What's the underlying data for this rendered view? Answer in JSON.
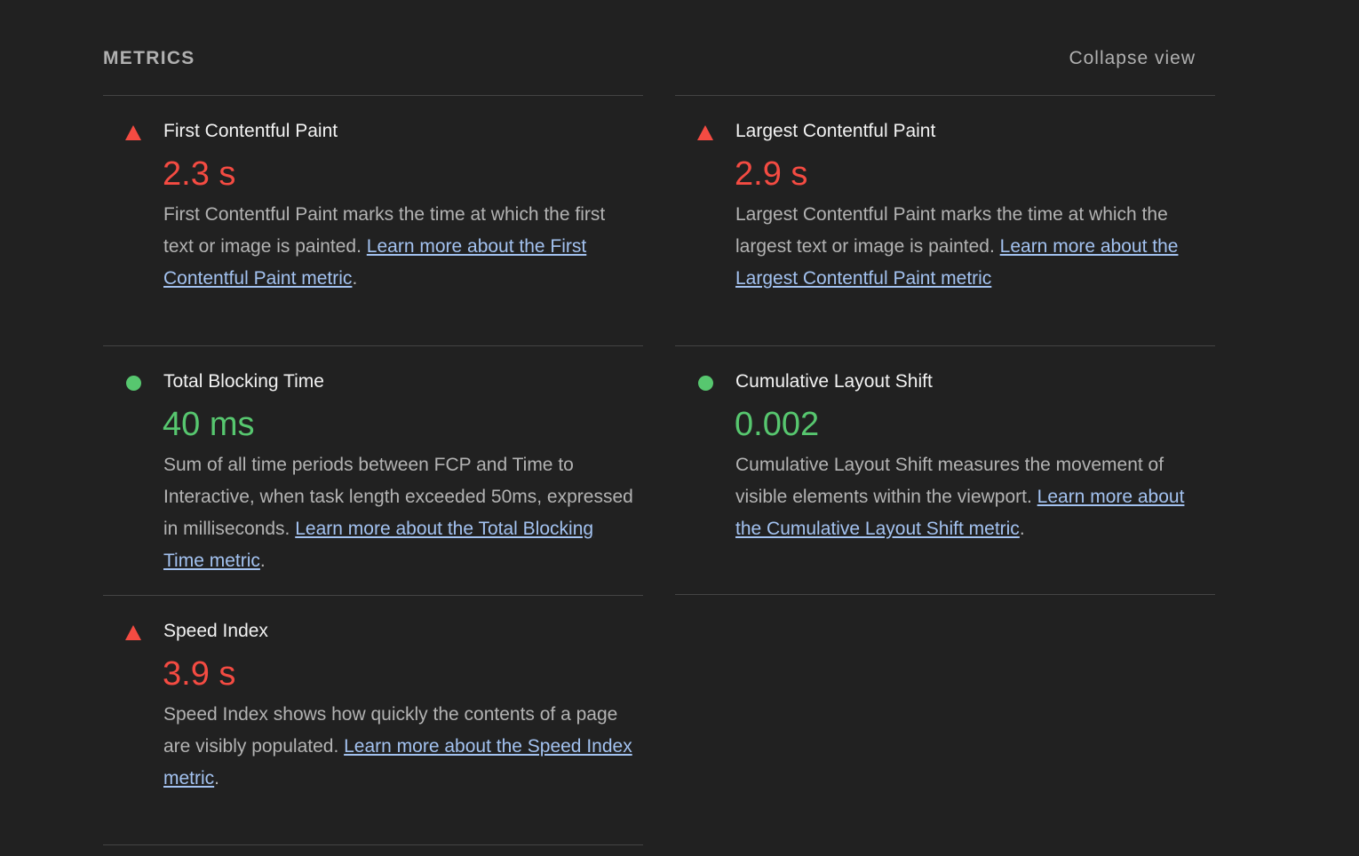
{
  "header": {
    "title": "METRICS",
    "collapse_label": "Collapse view"
  },
  "colors": {
    "background": "#212121",
    "fail": "#f44b42",
    "pass": "#57c76f",
    "link": "#a3c2f0"
  },
  "metrics": [
    {
      "name": "First Contentful Paint",
      "value": "2.3 s",
      "status": "fail",
      "indicator_icon": "red-triangle-icon",
      "description": "First Contentful Paint marks the time at which the first text or image is painted. ",
      "link_text": "Learn more about the First Contentful Paint metric",
      "suffix": "."
    },
    {
      "name": "Largest Contentful Paint",
      "value": "2.9 s",
      "status": "fail",
      "indicator_icon": "red-triangle-icon",
      "description": "Largest Contentful Paint marks the time at which the largest text or image is painted. ",
      "link_text": "Learn more about the Largest Contentful Paint metric",
      "suffix": ""
    },
    {
      "name": "Total Blocking Time",
      "value": "40 ms",
      "status": "pass",
      "indicator_icon": "green-circle-icon",
      "description": "Sum of all time periods between FCP and Time to Interactive, when task length exceeded 50ms, expressed in milliseconds. ",
      "link_text": "Learn more about the Total Blocking Time metric",
      "suffix": "."
    },
    {
      "name": "Cumulative Layout Shift",
      "value": "0.002",
      "status": "pass",
      "indicator_icon": "green-circle-icon",
      "description": "Cumulative Layout Shift measures the movement of visible elements within the viewport. ",
      "link_text": "Learn more about the Cumulative Layout Shift metric",
      "suffix": "."
    },
    {
      "name": "Speed Index",
      "value": "3.9 s",
      "status": "fail",
      "indicator_icon": "red-triangle-icon",
      "description": "Speed Index shows how quickly the contents of a page are visibly populated. ",
      "link_text": "Learn more about the Speed Index metric",
      "suffix": "."
    }
  ]
}
